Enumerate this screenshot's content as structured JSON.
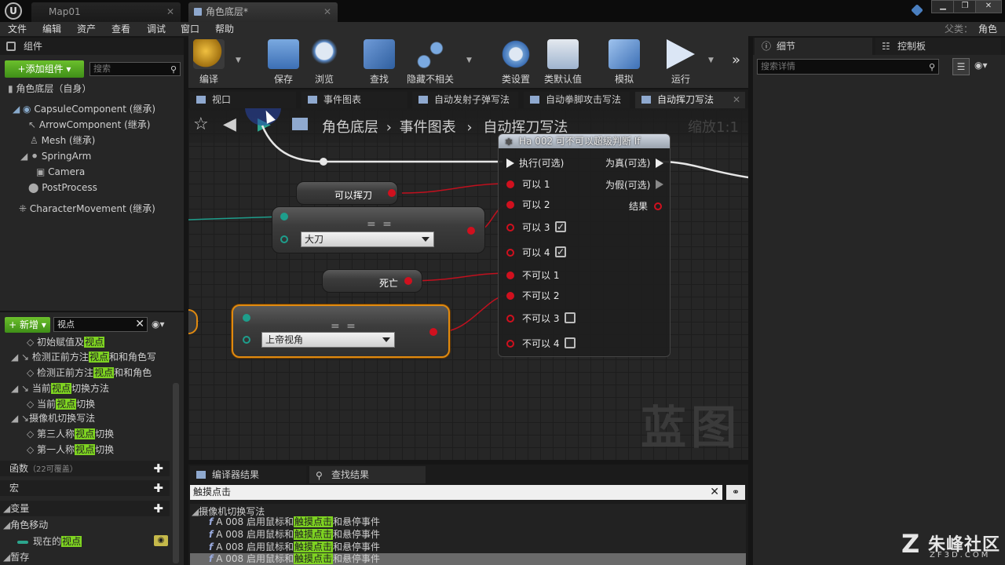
{
  "titlebar": {
    "logo": "U",
    "tabs": [
      {
        "label": "Map01"
      },
      {
        "label": "角色底层*"
      }
    ],
    "parent_label": "父类：",
    "parent_value": "角色"
  },
  "menu": [
    "文件",
    "编辑",
    "资产",
    "查看",
    "调试",
    "窗口",
    "帮助"
  ],
  "components_panel": {
    "title": "组件",
    "add_label": "+添加组件 ▾",
    "search_placeholder": "搜索",
    "root": "角色底层（自身）",
    "items": [
      "CapsuleComponent (继承)",
      "ArrowComponent (继承)",
      "Mesh (继承)",
      "SpringArm",
      "Camera",
      "PostProcess",
      "CharacterMovement (继承)"
    ]
  },
  "my_blueprint": {
    "new_label": "+ 新增 ▾",
    "search_value": "视点",
    "items": [
      {
        "pre": "初始赋值及",
        "hl": "视点",
        "post": ""
      },
      {
        "pre": "检测正前方注",
        "hl": "视点",
        "post": "和和角色写"
      },
      {
        "pre": "检测正前方注",
        "hl": "视点",
        "post": "和和角色"
      },
      {
        "pre": "当前",
        "hl": "视点",
        "post": "切换方法"
      },
      {
        "pre": "当前",
        "hl": "视点",
        "post": "切换"
      },
      {
        "pre": "摄像机切换写法",
        "hl": "",
        "post": ""
      },
      {
        "pre": "第三人称",
        "hl": "视点",
        "post": "切换"
      },
      {
        "pre": "第一人称",
        "hl": "视点",
        "post": "切换"
      }
    ],
    "sections": [
      {
        "label": "函数",
        "note": "（22可覆盖）"
      },
      {
        "label": "宏",
        "note": ""
      },
      {
        "label": "变量",
        "note": ""
      }
    ],
    "var_category": "角色移动",
    "var_pre": "现在的",
    "var_hl": "视点",
    "last_section": "暂存"
  },
  "toolbar": {
    "buttons": [
      "编译",
      "保存",
      "浏览",
      "查找",
      "隐藏不相关",
      "类设置",
      "类默认值",
      "模拟",
      "运行"
    ]
  },
  "graph_tabs": [
    "视口",
    "事件图表",
    "自动发射子弹写法",
    "自动拳脚攻击写法",
    "自动挥刀写法"
  ],
  "breadcrumb": [
    "角色底层",
    "事件图表",
    "自动挥刀写法"
  ],
  "zoom": "缩放1:1",
  "watermark": "蓝图",
  "nodes": {
    "can_swing": "可以挥刀",
    "dead": "死亡",
    "eq_symbol": "= =",
    "combo_1": "大刀",
    "combo_2": "上帝视角",
    "if_title": "Ha 002 可不可以超级判断 If",
    "if_inputs": [
      "执行(可选)",
      "可以 1",
      "可以 2",
      "可以 3",
      "可以 4",
      "不可以 1",
      "不可以 2",
      "不可以 3",
      "不可以 4"
    ],
    "if_outputs": [
      "为真(可选)",
      "为假(可选)",
      "结果"
    ]
  },
  "details_panel": {
    "tab_details": "细节",
    "tab_palette": "控制板",
    "search_placeholder": "搜索详情"
  },
  "bottom": {
    "tab_compiler": "编译器结果",
    "tab_find": "查找结果",
    "search_value": "触摸点击",
    "group": "摄像机切换写法",
    "rows": [
      {
        "pre": "A 008 启用鼠标和",
        "hl": "触摸点击",
        "post": "和悬停事件"
      },
      {
        "pre": "A 008 启用鼠标和",
        "hl": "触摸点击",
        "post": "和悬停事件"
      },
      {
        "pre": "A 008 启用鼠标和",
        "hl": "触摸点击",
        "post": "和悬停事件"
      },
      {
        "pre": "A 008 启用鼠标和",
        "hl": "触摸点击",
        "post": "和悬停事件"
      }
    ]
  },
  "brand": {
    "name": "朱峰社区",
    "url": "ZF3D.COM"
  }
}
